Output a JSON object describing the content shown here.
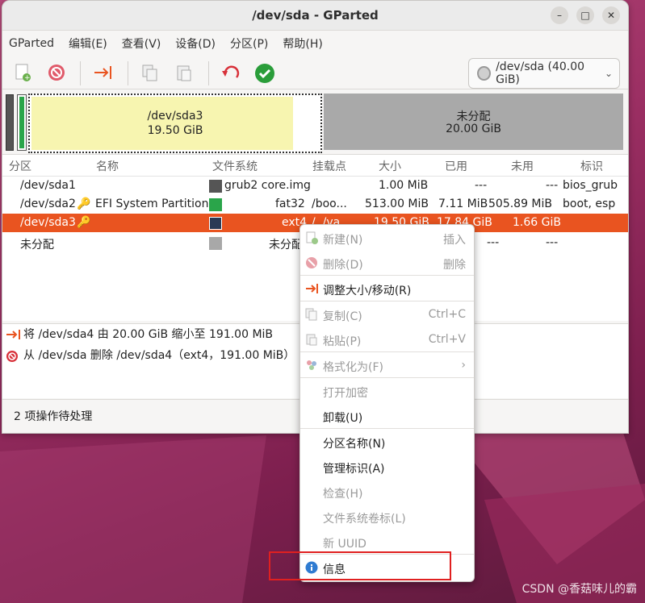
{
  "window": {
    "title": "/dev/sda - GParted",
    "controls": {
      "minimize": "–",
      "maximize": "□",
      "close": "✕"
    }
  },
  "menubar": [
    "GParted",
    "编辑(E)",
    "查看(V)",
    "设备(D)",
    "分区(P)",
    "帮助(H)"
  ],
  "toolbar": {
    "device_selector": "/dev/sda (40.00 GiB)"
  },
  "diskmap": {
    "sda3": {
      "name": "/dev/sda3",
      "size": "19.50 GiB"
    },
    "unalloc": {
      "name": "未分配",
      "size": "20.00 GiB"
    }
  },
  "table": {
    "headers": [
      "分区",
      "名称",
      "文件系统",
      "挂载点",
      "大小",
      "已用",
      "未用",
      "标识"
    ],
    "rows": [
      {
        "partition": "/dev/sda1",
        "name": "",
        "fs": "grub2 core.img",
        "mount": "",
        "size": "1.00 MiB",
        "used": "---",
        "unused": "---",
        "flags": "bios_grub",
        "color": "#555555"
      },
      {
        "partition": "/dev/sda2",
        "name": "EFI System Partition",
        "fs": "fat32",
        "mount": "/boo...",
        "size": "513.00 MiB",
        "used": "7.11 MiB",
        "unused": "505.89 MiB",
        "flags": "boot, esp",
        "color": "#2aa54a"
      },
      {
        "partition": "/dev/sda3",
        "name": "",
        "fs": "ext4",
        "mount": "/, /va",
        "size": "19.50 GiB",
        "used": "17.84 GiB",
        "unused": "1.66 GiB",
        "flags": "",
        "color": "#2a3a55"
      },
      {
        "partition": "未分配",
        "name": "",
        "fs": "未分配",
        "mount": "",
        "size": "",
        "used": "---",
        "unused": "---",
        "flags": "",
        "color": "#a8a8a8"
      }
    ]
  },
  "operations": [
    "将 /dev/sda4 由 20.00 GiB 缩小至 191.00 MiB",
    "从 /dev/sda 删除 /dev/sda4（ext4，191.00 MiB）"
  ],
  "status": "2 项操作待处理",
  "context_menu": {
    "new": {
      "label": "新建(N)",
      "accel": "插入"
    },
    "delete": {
      "label": "删除(D)",
      "accel": "删除"
    },
    "resize": {
      "label": "调整大小/移动(R)"
    },
    "copy": {
      "label": "复制(C)",
      "accel": "Ctrl+C"
    },
    "paste": {
      "label": "粘贴(P)",
      "accel": "Ctrl+V"
    },
    "format": {
      "label": "格式化为(F)"
    },
    "open_encryption": {
      "label": "打开加密"
    },
    "unmount": {
      "label": "卸载(U)"
    },
    "name_partition": {
      "label": "分区名称(N)"
    },
    "manage_flags": {
      "label": "管理标识(A)"
    },
    "check": {
      "label": "检查(H)"
    },
    "label_fs": {
      "label": "文件系统卷标(L)"
    },
    "new_uuid": {
      "label": "新 UUID"
    },
    "info": {
      "label": "信息"
    }
  },
  "watermark": "CSDN @香菇味儿的霸",
  "colors": {
    "accent": "#e95420",
    "highlight": "#e02020",
    "sda3_fill": "#f7f5b0",
    "unalloc_fill": "#a9a9a9"
  }
}
